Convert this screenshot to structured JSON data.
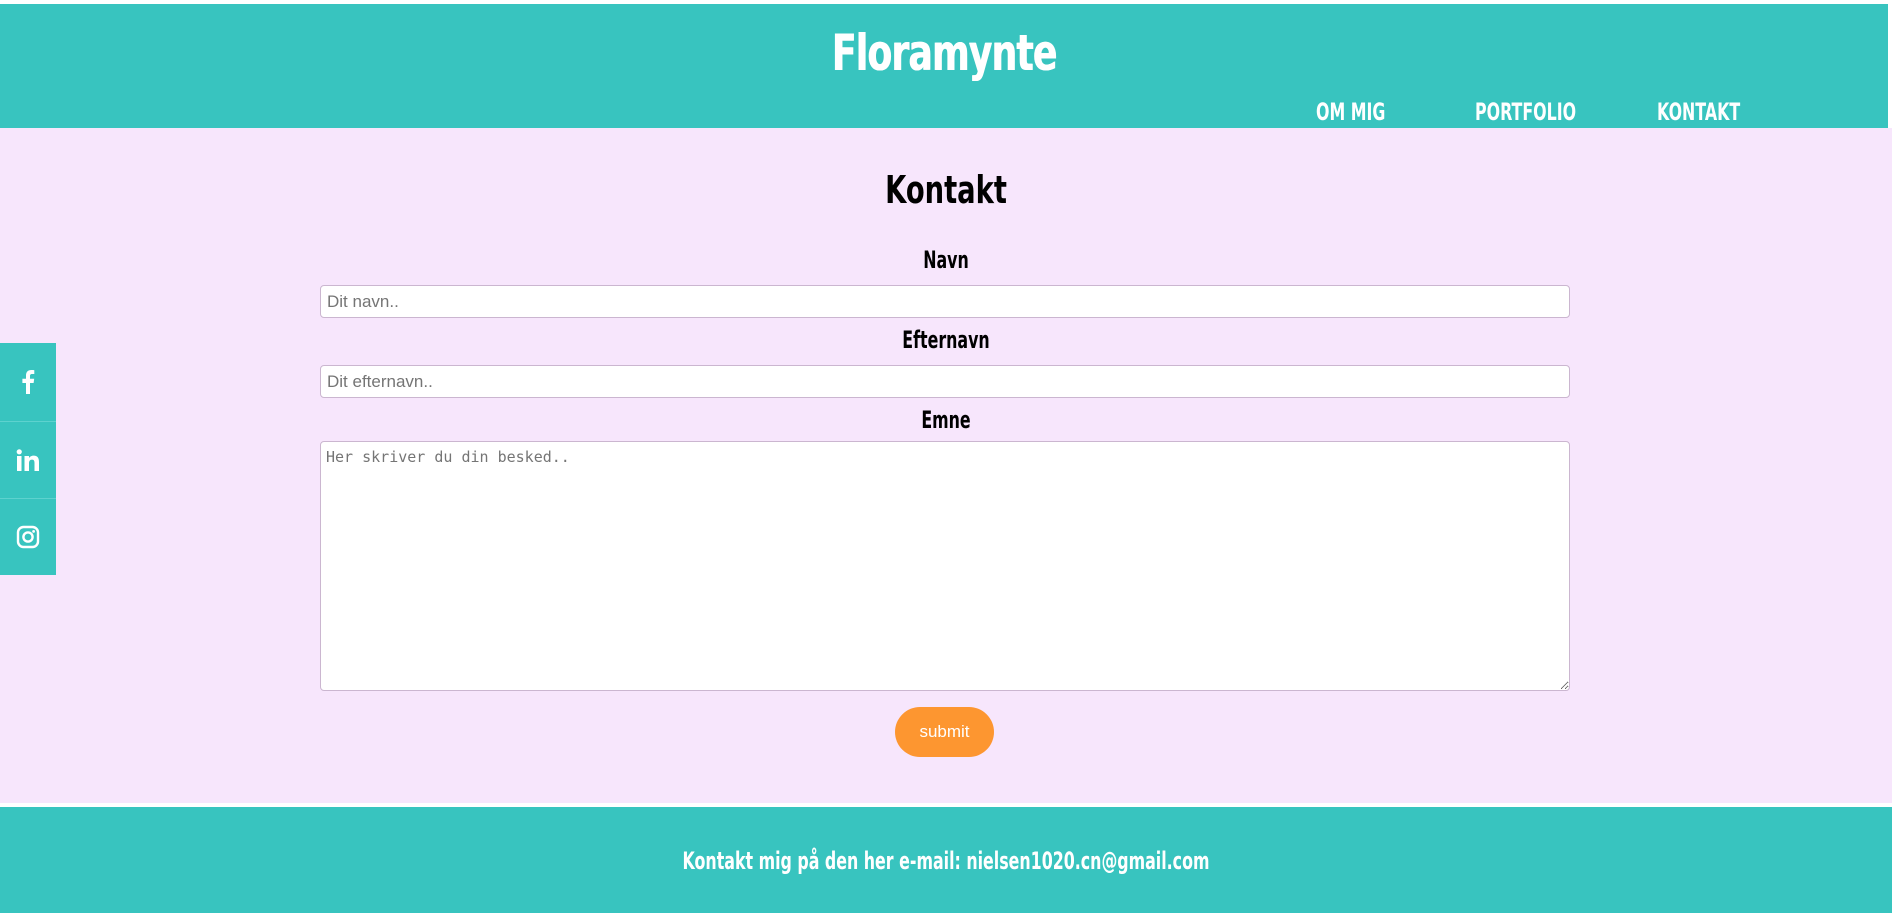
{
  "header": {
    "site_title": "Floramynte",
    "nav": [
      "OM MIG",
      "PORTFOLIO",
      "KONTAKT"
    ]
  },
  "main": {
    "title": "Kontakt",
    "form": {
      "first_name_label": "Navn",
      "first_name_placeholder": "Dit navn..",
      "last_name_label": "Efternavn",
      "last_name_placeholder": "Dit efternavn..",
      "subject_label": "Emne",
      "message_placeholder": "Her skriver du din besked..",
      "submit_label": "submit"
    }
  },
  "social": {
    "icons": [
      "facebook-icon",
      "linkedin-icon",
      "instagram-icon"
    ]
  },
  "footer": {
    "text": "Kontakt mig på den her e-mail: nielsen1020.cn@gmail.com"
  },
  "colors": {
    "teal": "#38c4bf",
    "lavender": "#f7e6fc",
    "orange": "#fd9630",
    "white": "#ffffff"
  }
}
